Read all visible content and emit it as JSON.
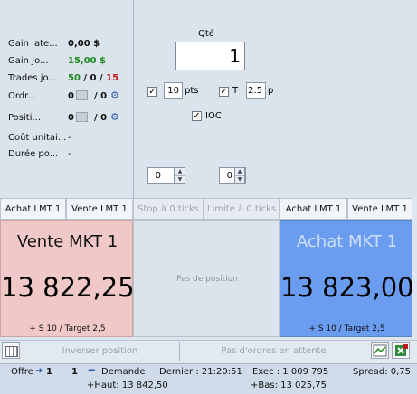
{
  "stats": {
    "gain_latent": {
      "label": "Gain late...",
      "value": "0,00 $"
    },
    "gain_jour": {
      "label": "Gain Jo...",
      "value": "15,00 $"
    },
    "trades": {
      "label": "Trades jo...",
      "val1": "50",
      "sep1": " / ",
      "val2": "0",
      "sep2": " / ",
      "val3": "15"
    },
    "ordres": {
      "label": "Ordr...",
      "val1": "0",
      "sep": "/ ",
      "val2": "0"
    },
    "positions": {
      "label": "Positi...",
      "val1": "0",
      "sep": "/ ",
      "val2": "0"
    },
    "cout": {
      "label": "Coût unitai...",
      "value": "-"
    },
    "duree": {
      "label": "Durée po...",
      "value": "-"
    }
  },
  "order": {
    "qty_label": "Qté",
    "qty_value": "1",
    "stop_value": "10",
    "stop_unit": "pts",
    "target_label": "T",
    "target_value": "2.5",
    "target_unit": "p",
    "ioc_label": "IOC",
    "spinner_left": "0",
    "spinner_right": "0"
  },
  "buttons": {
    "achat_lmt_left": "Achat LMT 1",
    "vente_lmt_left": "Vente LMT 1",
    "stop_zero": "Stop à 0 ticks",
    "limit_zero": "Limite à 0 ticks",
    "achat_lmt_right": "Achat LMT 1",
    "vente_lmt_right": "Vente LMT 1"
  },
  "sell": {
    "title": "Vente MKT 1",
    "price": "13 822,25",
    "footer": "+ S 10 / Target 2,5"
  },
  "buy": {
    "title": "Achat MKT 1",
    "price": "13 823,00",
    "footer": "+ S 10 / Target 2,5"
  },
  "middle": {
    "no_position": "Pas de position"
  },
  "bottom": {
    "inverse": "Inverser position",
    "no_orders": "Pas d'ordres en attente"
  },
  "status": {
    "offre_label": "Offre",
    "offre_value": "1",
    "demande_value": "1",
    "demande_label": "Demande",
    "dernier": "Dernier :  21:20:51",
    "exec": "Exec :  1 009 795",
    "spread": "Spread:  0,75",
    "haut": "+Haut:  13 842,50",
    "bas": "+Bas:  13 025,75"
  },
  "colors": {
    "sell_bg": "#f1c8c8",
    "buy_bg": "#6a9cf0",
    "gain_green": "#1f8a1f",
    "loss_red": "#c01818"
  }
}
